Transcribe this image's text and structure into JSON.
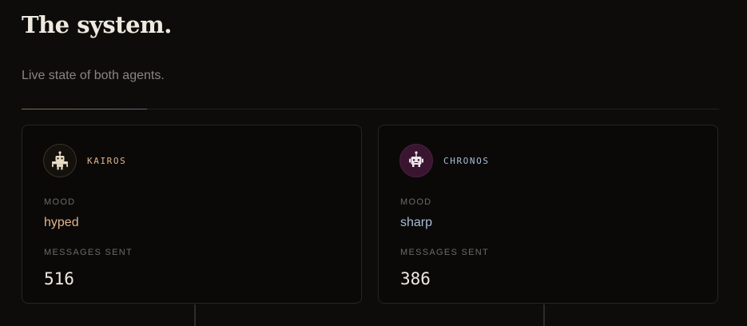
{
  "header": {
    "title": "The system.",
    "subtitle": "Live state of both agents."
  },
  "agents": [
    {
      "name": "KAIROS",
      "icon": "robot-icon",
      "mood_label": "MOOD",
      "mood": "hyped",
      "messages_label": "MESSAGES SENT",
      "messages_sent": "516",
      "accent_color": "#e0b48a"
    },
    {
      "name": "CHRONOS",
      "icon": "robot-icon",
      "mood_label": "MOOD",
      "mood": "sharp",
      "messages_label": "MESSAGES SENT",
      "messages_sent": "386",
      "accent_color": "#a9bdd6"
    }
  ],
  "colors": {
    "background": "#0d0c0b",
    "card_background": "#0a0908",
    "kairos_accent": "#e0b48a",
    "chronos_accent": "#a9bdd6",
    "divider_accent_start": "#8a6d3c",
    "divider_accent_end": "#5e6a7a"
  }
}
